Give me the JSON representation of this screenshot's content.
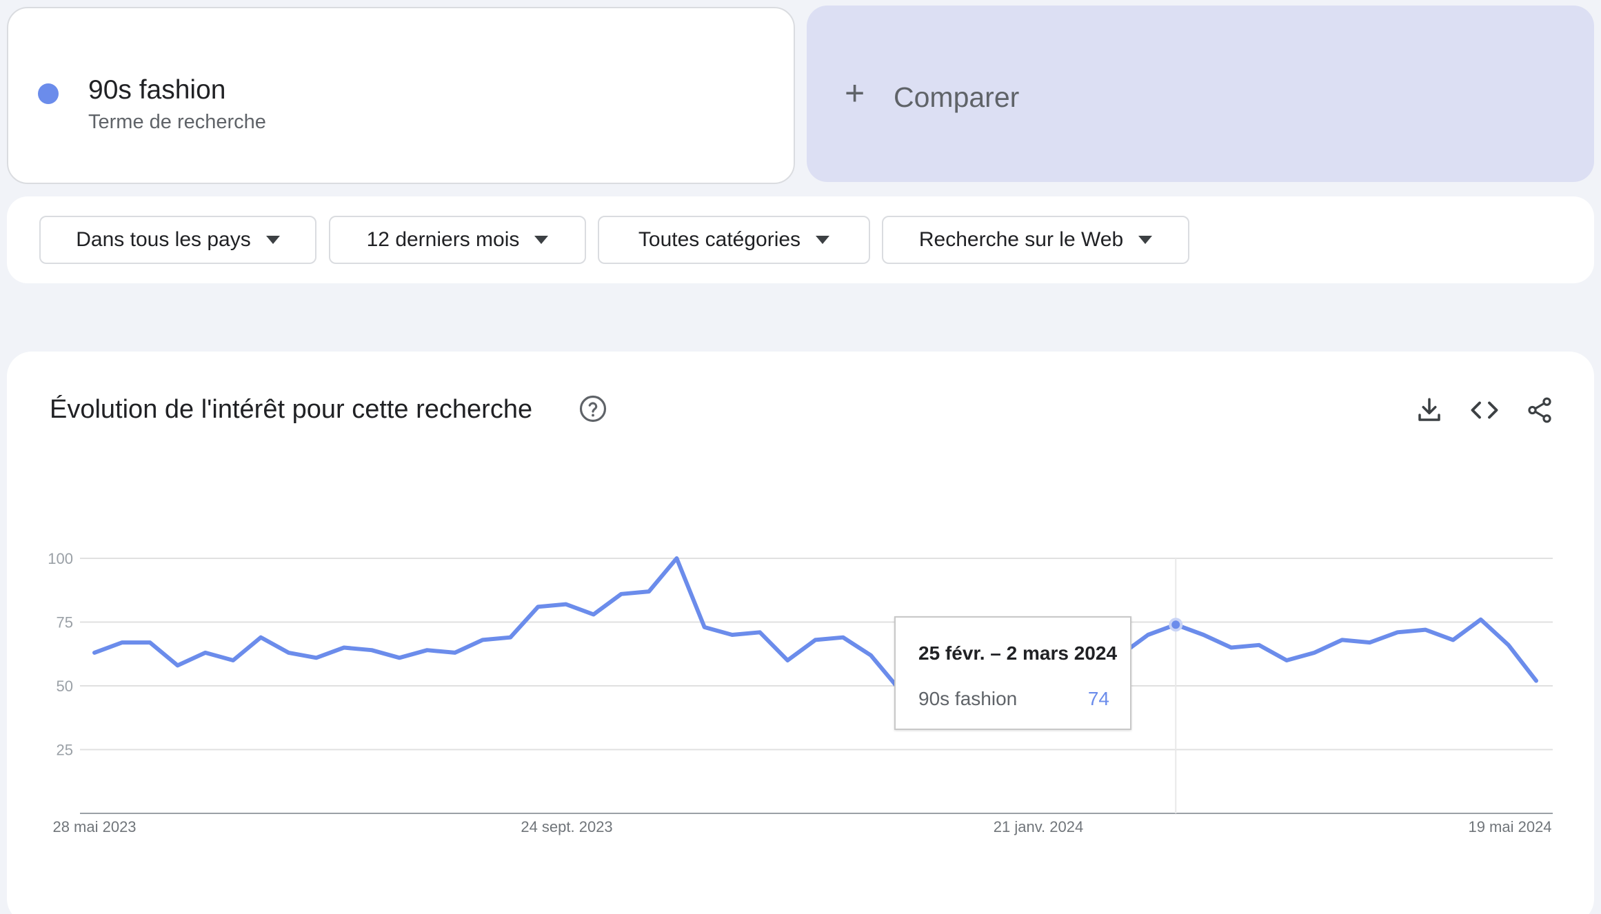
{
  "term": {
    "name": "90s fashion",
    "type": "Terme de recherche",
    "color": "#6b8ceb"
  },
  "compare": {
    "label": "Comparer"
  },
  "filters": [
    {
      "label": "Dans tous les pays"
    },
    {
      "label": "12 derniers mois"
    },
    {
      "label": "Toutes catégories"
    },
    {
      "label": "Recherche sur le Web"
    }
  ],
  "chart": {
    "title": "Évolution de l'intérêt pour cette recherche",
    "icons": [
      "help-icon",
      "download-icon",
      "embed-icon",
      "share-icon"
    ]
  },
  "tooltip": {
    "date": "25 févr. – 2 mars 2024",
    "series": "90s fashion",
    "value": "74"
  },
  "chart_data": {
    "type": "line",
    "x_labels": [
      "28 mai 2023",
      "24 sept. 2023",
      "21 janv. 2024",
      "19 mai 2024"
    ],
    "y_ticks": [
      25,
      50,
      75,
      100
    ],
    "ylim": [
      0,
      100
    ],
    "grid": true,
    "series": [
      {
        "name": "90s fashion",
        "color": "#6b8ceb",
        "values": [
          63,
          67,
          67,
          58,
          63,
          60,
          69,
          63,
          61,
          65,
          64,
          61,
          64,
          63,
          68,
          69,
          81,
          82,
          78,
          86,
          87,
          100,
          73,
          70,
          71,
          60,
          68,
          69,
          62,
          49,
          52,
          54,
          57,
          63,
          67,
          71,
          72,
          62,
          70,
          74,
          70,
          65,
          66,
          60,
          63,
          68,
          67,
          71,
          72,
          68,
          76,
          66,
          52
        ]
      }
    ],
    "highlight_index": 39
  }
}
